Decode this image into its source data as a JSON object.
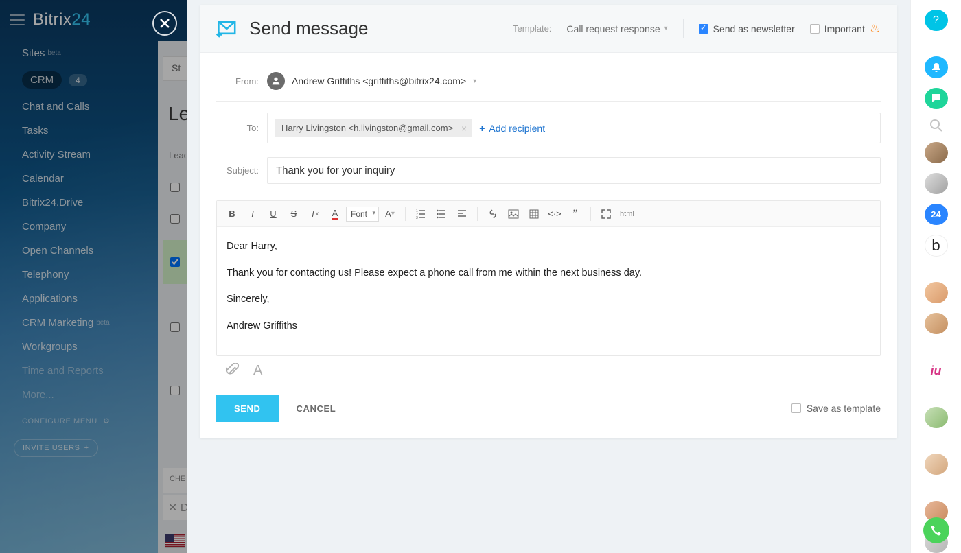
{
  "app": {
    "name_a": "Bitrix",
    "name_b": "24"
  },
  "sidenav": {
    "items": [
      {
        "label": "Sites",
        "beta": "beta"
      },
      {
        "label": "CRM",
        "count": "4",
        "active": true
      },
      {
        "label": "Chat and Calls"
      },
      {
        "label": "Tasks"
      },
      {
        "label": "Activity Stream"
      },
      {
        "label": "Calendar"
      },
      {
        "label": "Bitrix24.Drive"
      },
      {
        "label": "Company"
      },
      {
        "label": "Open Channels"
      },
      {
        "label": "Telephony"
      },
      {
        "label": "Applications"
      },
      {
        "label": "CRM Marketing",
        "beta": "beta"
      },
      {
        "label": "Workgroups"
      },
      {
        "label": "Time and Reports"
      },
      {
        "label": "More..."
      }
    ],
    "configure": "CONFIGURE MENU",
    "invite": "INVITE USERS"
  },
  "leads_bg": {
    "tab": "St",
    "title": "Le",
    "sub": "Lead",
    "che": "CHE",
    "del": "D"
  },
  "dialog": {
    "title": "Send message",
    "template_label": "Template:",
    "template_value": "Call request response",
    "newsletter_label": "Send as newsletter",
    "important_label": "Important",
    "from_label": "From:",
    "from_value": "Andrew Griffiths <griffiths@bitrix24.com>",
    "to_label": "To:",
    "recipient": "Harry Livingston <h.livingston@gmail.com>",
    "add_recipient": "Add recipient",
    "subject_label": "Subject:",
    "subject_value": "Thank you for your inquiry",
    "toolbar": {
      "font": "Font",
      "html": "html"
    },
    "body": {
      "p1": "Dear Harry,",
      "p2": "Thank you for contacting us! Please expect a phone call from me within the next business day.",
      "p3": "Sincerely,",
      "p4": "Andrew Griffiths"
    },
    "send": "SEND",
    "cancel": "CANCEL",
    "save_template": "Save as template"
  },
  "rail": {
    "b24": "24",
    "b": "b",
    "iu": "iu"
  }
}
